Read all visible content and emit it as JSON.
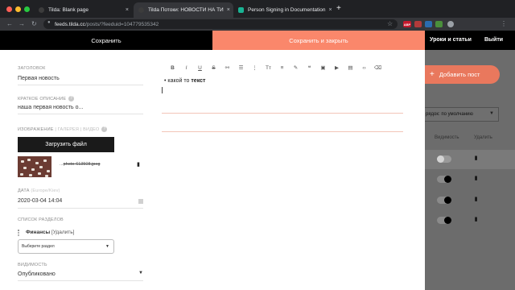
{
  "browser": {
    "tabs": [
      {
        "title": "Tilda: Blank page",
        "active": false,
        "favicon_color": "#3c3c3c"
      },
      {
        "title": "Tilda Потоки: НОВОСТИ НА ТИ",
        "active": true,
        "favicon_color": "#3c3c3c"
      },
      {
        "title": "Person Signing in Documentation",
        "active": false,
        "favicon_color": "#19b394"
      }
    ],
    "close_glyph": "×",
    "new_tab_glyph": "+",
    "url_host": "feeds.tilda.cc",
    "url_path": "/posts/?feeduid=104779535342",
    "nav": {
      "back": "←",
      "forward": "→",
      "reload": "↻",
      "lock": "🔒",
      "star": "☆"
    },
    "extensions": [
      {
        "label": "ABP",
        "color": "#c5192d"
      },
      {
        "label": "",
        "color": "#b23a3a"
      },
      {
        "label": "",
        "color": "#2b6cb0"
      },
      {
        "label": "",
        "color": "#4a8f3b"
      }
    ]
  },
  "tilda_bar": {
    "save_label": "Сохранить",
    "save_close_label": "Сохранить и закрыть",
    "links": [
      "Уроки и статьи",
      "Выйти"
    ]
  },
  "form": {
    "title_label": "ЗАГОЛОВОК",
    "title_value": "Первая новость",
    "desc_label": "КРАТКОЕ ОПИСАНИЕ",
    "desc_value": "наша первая новость о...",
    "image_label": "ИЗОБРАЖЕНИЕ",
    "image_sub": "| ГАЛЕРЕЯ | ВИДЕО",
    "upload_label": "Загрузить файл",
    "file_prefix": "...",
    "file_name": "photo-613508.jpeg",
    "date_label": "ДАТА",
    "date_sub": "(Europe/Kiev)",
    "date_value": "2020-03-04 14:04",
    "sections_label": "СПИСОК РАЗДЕЛОВ",
    "section_name": "Финансы",
    "section_remove": "[Удалить]",
    "select_placeholder": "Выберите раздел",
    "visibility_label": "ВИДИМОСТЬ",
    "visibility_value": "Опубликовано",
    "help_glyph": "?"
  },
  "editor": {
    "toolbar": [
      {
        "name": "bold-icon",
        "glyph": "B"
      },
      {
        "name": "italic-icon",
        "glyph": "I"
      },
      {
        "name": "underline-icon",
        "glyph": "U"
      },
      {
        "name": "strikethrough-icon",
        "glyph": "S"
      },
      {
        "name": "link-icon",
        "glyph": "⚯"
      },
      {
        "name": "bulleted-list-icon",
        "glyph": "☰"
      },
      {
        "name": "numbered-list-icon",
        "glyph": "⋮"
      },
      {
        "name": "text-size-icon",
        "glyph": "Tт"
      },
      {
        "name": "align-icon",
        "glyph": "≡"
      },
      {
        "name": "highlight-icon",
        "glyph": "✎"
      },
      {
        "name": "quote-icon",
        "glyph": "❝"
      },
      {
        "name": "image-icon",
        "glyph": "▣"
      },
      {
        "name": "video-icon",
        "glyph": "▶"
      },
      {
        "name": "embed-icon",
        "glyph": "▤"
      },
      {
        "name": "code-icon",
        "glyph": "‹›"
      },
      {
        "name": "eraser-icon",
        "glyph": "⌫"
      }
    ],
    "bullet_text": "какой то ",
    "bullet_bold": "текст"
  },
  "posts_panel": {
    "add_post_label": "Добавить пост",
    "add_post_plus": "+",
    "sort_label": "рядок: по умолчанию",
    "visibility_col": "Видимость",
    "delete_col": "Удалить",
    "rows": [
      {
        "visible": false
      },
      {
        "visible": true
      },
      {
        "visible": true
      },
      {
        "visible": true
      }
    ]
  },
  "colors": {
    "accent": "#fa876b",
    "chrome_dark": "#202124",
    "tilda_black": "#000000"
  }
}
